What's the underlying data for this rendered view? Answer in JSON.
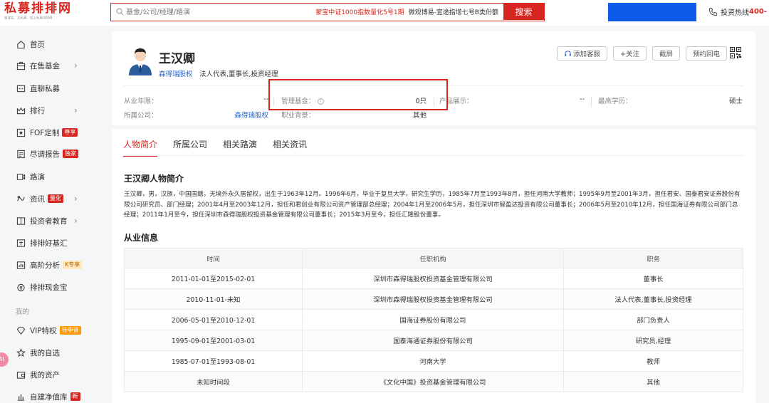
{
  "header": {
    "logo_text": "私募排排网",
    "logo_sub": "查排名、买私募、就上私募排排网",
    "search_placeholder": "基金/公司/经理/路演",
    "hot_link_1": "蒙宝中证1000指数量化5号1期",
    "hot_link_2": "微观博易-宣途指增七号B类份额",
    "search_button": "搜索",
    "hotline_label": "投资热线",
    "hotline_number": "400-"
  },
  "sidebar": {
    "items": [
      {
        "label": "首页",
        "icon": "home-icon"
      },
      {
        "label": "在售基金",
        "icon": "briefcase-icon"
      },
      {
        "label": "直聊私募",
        "icon": "chat-icon"
      },
      {
        "label": "排行",
        "icon": "crown-icon"
      },
      {
        "label": "FOF定制",
        "icon": "star-box-icon",
        "badge": "尊享"
      },
      {
        "label": "尽调报告",
        "icon": "report-icon",
        "badge": "独家"
      },
      {
        "label": "路演",
        "icon": "video-icon"
      },
      {
        "label": "资讯",
        "icon": "news-icon",
        "badge": "量化"
      },
      {
        "label": "投资者教育",
        "icon": "book-icon"
      },
      {
        "label": "排排好基汇",
        "icon": "fund-icon"
      },
      {
        "label": "高阶分析",
        "icon": "analysis-icon",
        "badge": "K专享"
      },
      {
        "label": "排排现金宝",
        "icon": "cash-icon"
      }
    ],
    "section_mine": "我的",
    "mine_items": [
      {
        "label": "VIP特权",
        "icon": "diamond-icon",
        "badge": "待申请"
      },
      {
        "label": "我的自选",
        "icon": "star-icon"
      },
      {
        "label": "我的资产",
        "icon": "wallet-icon"
      },
      {
        "label": "自建净值库",
        "icon": "database-icon",
        "badge": "新"
      }
    ],
    "float_avatar": "AI"
  },
  "profile": {
    "name": "王汉卿",
    "company": "森得瑞股权",
    "roles": "法人代表,董事长,投资经理",
    "actions": [
      "添加客服",
      "+关注",
      "截屏",
      "预约回电"
    ],
    "fields": {
      "years_label": "从业年限：",
      "years_value": "--",
      "company_label": "所属公司：",
      "company_value": "森得瑞股权",
      "managed_label": "管理基金：",
      "managed_value": "0只",
      "background_label": "职业背景：",
      "background_value": "其他",
      "products_label": "产品展示：",
      "products_value": "--",
      "education_label": "最高学历：",
      "education_value": "硕士"
    }
  },
  "tabs": [
    {
      "label": "人物简介",
      "active": true
    },
    {
      "label": "所属公司",
      "active": false
    },
    {
      "label": "相关路演",
      "active": false
    },
    {
      "label": "相关资讯",
      "active": false
    }
  ],
  "bio": {
    "title": "王汉卿人物简介",
    "text": "王汉卿，男，汉族，中国国籍，无境外永久居留权，出生于1963年12月。1996年6月，毕业于复旦大学，研究生学历，1985年7月至1993年8月，担任河南大学教师；1995年9月至2001年3月，担任君安、国泰君安证券股份有限公司研究员、部门经理；2001年4月至2003年12月，担任和君创业有限公司资产管理部总经理；2004年1月至2006年5月，担任深圳市智盈达投资有限公司董事长；2006年5月至2010年12月，担任国海证券有限公司部门总经理；2011年1月至今，担任深圳市森得瑞股权投资基金管理有限公司董事长；2015年3月至今，担任汇隆股份董事。"
  },
  "career": {
    "title": "从业信息",
    "columns": [
      "时间",
      "任职机构",
      "职务"
    ],
    "rows": [
      [
        "2011-01-01至2015-02-01",
        "深圳市森得瑞股权投资基金管理有限公司",
        "董事长"
      ],
      [
        "2010-11-01-未知",
        "深圳市森得瑞股权投资基金管理有限公司",
        "法人代表,董事长,投资经理"
      ],
      [
        "2006-05-01至2010-12-01",
        "国海证券股份有限公司",
        "部门负责人"
      ],
      [
        "1995-09-01至2001-03-01",
        "国泰海通证券股份有限公司",
        "研究员,经理"
      ],
      [
        "1985-07-01至1993-08-01",
        "河南大学",
        "教师"
      ],
      [
        "未知时间段",
        "《文化中国》投资基金管理有限公司",
        "其他"
      ]
    ]
  },
  "colors": {
    "brand_red": "#d7261f",
    "link_blue": "#2a63c8",
    "banner_blue": "#0d5be8"
  }
}
